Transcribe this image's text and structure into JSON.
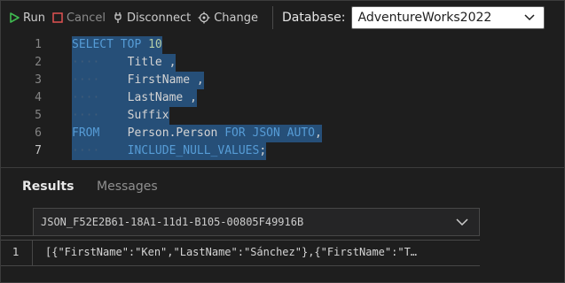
{
  "toolbar": {
    "run_label": "Run",
    "cancel_label": "Cancel",
    "disconnect_label": "Disconnect",
    "change_label": "Change",
    "database_label": "Database:",
    "database_value": "AdventureWorks2022"
  },
  "editor": {
    "line_numbers": [
      "1",
      "2",
      "3",
      "4",
      "5",
      "6",
      "7"
    ],
    "lines": [
      {
        "kw1": "SELECT",
        "sp1": " ",
        "kw2": "TOP",
        "rest": " 10"
      },
      {
        "indent": "····",
        "text": "Title ,"
      },
      {
        "indent": "····",
        "text": "FirstName ,"
      },
      {
        "indent": "····",
        "text": "LastName ,"
      },
      {
        "indent": "····",
        "text": "Suffix"
      },
      {
        "kw1": "FROM",
        "sp1": "    ",
        "text": "Person.Person",
        "kw2": "FOR JSON AUTO",
        "rest": ","
      },
      {
        "indent": "····",
        "kw1": "INCLUDE_NULL_VALUES",
        "rest": ";"
      }
    ]
  },
  "results_panel": {
    "tabs": [
      "Results",
      "Messages"
    ],
    "column_header": "JSON_F52E2B61-18A1-11d1-B105-00805F49916B",
    "rows": [
      {
        "row_number": "1",
        "value": "[{\"FirstName\":\"Ken\",\"LastName\":\"Sánchez\"},{\"FirstName\":\"T…"
      }
    ]
  },
  "colors": {
    "run_icon": "#3fb950",
    "cancel_icon": "#e05252",
    "keyword": "#569cd6",
    "selection": "#264f78"
  }
}
